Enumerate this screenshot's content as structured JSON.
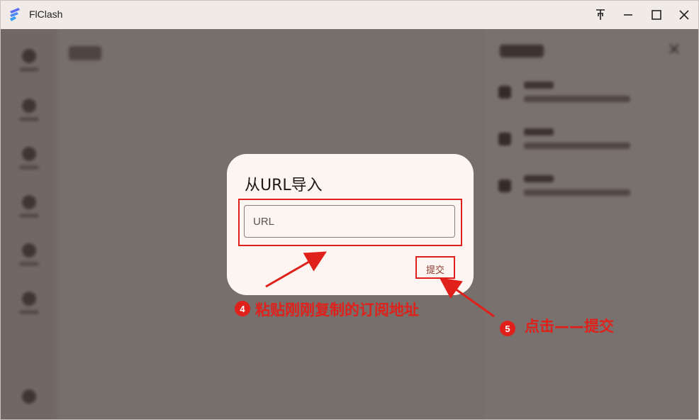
{
  "window": {
    "title": "FlClash",
    "controls": [
      "pin-icon",
      "minimize-icon",
      "maximize-icon",
      "close-icon"
    ]
  },
  "dialog": {
    "title": "从URL导入",
    "input_placeholder": "URL",
    "input_value": "",
    "submit_label": "提交"
  },
  "annotations": {
    "step4": {
      "number": "4",
      "text": "粘贴刚刚复制的订阅地址"
    },
    "step5": {
      "number": "5",
      "text": "点击——提交"
    }
  },
  "colors": {
    "annotation_red": "#e0211b",
    "dialog_bg": "#fdf5f1",
    "accent": "#8b3a2d"
  }
}
